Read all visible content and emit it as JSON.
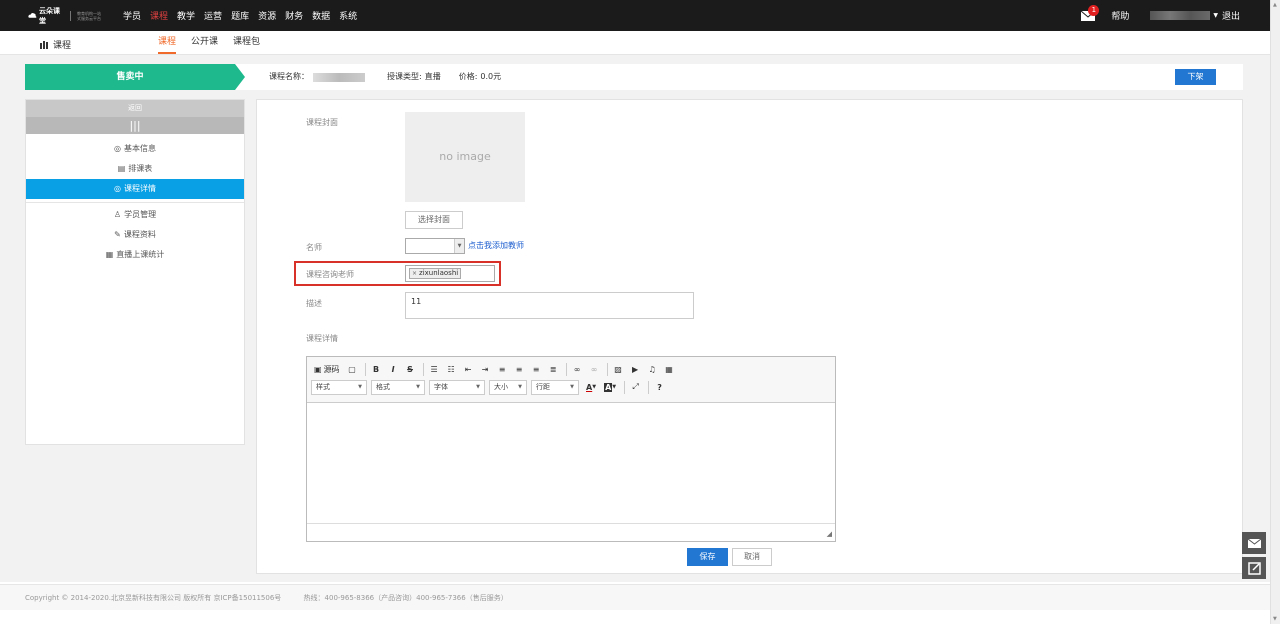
{
  "header": {
    "logo_text": "云朵课堂",
    "logo_slogan": "教育机构一站式服务云平台",
    "nav": [
      "学员",
      "课程",
      "教学",
      "运营",
      "题库",
      "资源",
      "财务",
      "数据",
      "系统"
    ],
    "active_nav_index": 1,
    "mail_badge": "1",
    "help": "帮助",
    "logout": "退出"
  },
  "subnav": {
    "section_title": "课程",
    "tabs": [
      "课程",
      "公开课",
      "课程包"
    ],
    "active_tab_index": 0
  },
  "status_bar": {
    "status": "售卖中",
    "course_name_label": "课程名称：",
    "course_type_label": "授课类型:",
    "course_type_value": "直播",
    "price_label": "价格:",
    "price_value": "0.0元",
    "off_shelf_button": "下架"
  },
  "sidebar": {
    "back": "返回",
    "collapse_icon": "|||",
    "items": [
      {
        "label": "基本信息",
        "icon": "info-icon"
      },
      {
        "label": "排课表",
        "icon": "schedule-icon"
      },
      {
        "label": "课程详情",
        "icon": "detail-icon",
        "active": true
      },
      {
        "label": "学员管理",
        "icon": "user-icon"
      },
      {
        "label": "课程资料",
        "icon": "material-icon"
      },
      {
        "label": "直播上课统计",
        "icon": "calendar-icon"
      }
    ]
  },
  "form": {
    "cover_label": "课程封面",
    "cover_placeholder": "no image",
    "select_cover_button": "选择封面",
    "teacher_label": "名师",
    "teacher_value": "",
    "add_teacher_link": "点击我添加教师",
    "consult_teacher_label": "课程咨询老师",
    "consult_teacher_tag": "zixunlaoshi",
    "description_label": "描述",
    "description_value": "11",
    "detail_label": "课程详情"
  },
  "editor": {
    "source_button": "源码",
    "combos": [
      "样式",
      "格式",
      "字体",
      "大小",
      "行距"
    ],
    "help_button": "?"
  },
  "actions": {
    "save": "保存",
    "cancel": "取消"
  },
  "footer": {
    "copyright": "Copyright © 2014-2020.北京昱新科技有限公司 版权所有 京ICP备15011506号",
    "hotline": "热线：400-965-8366（产品咨询）400-965-7366（售后服务）"
  },
  "colors": {
    "status_green": "#1eb98c",
    "primary_blue": "#2277d3",
    "active_menu": "#0aa0e6",
    "highlight_red": "#d8312a",
    "active_tab_orange": "#f06a2b"
  }
}
